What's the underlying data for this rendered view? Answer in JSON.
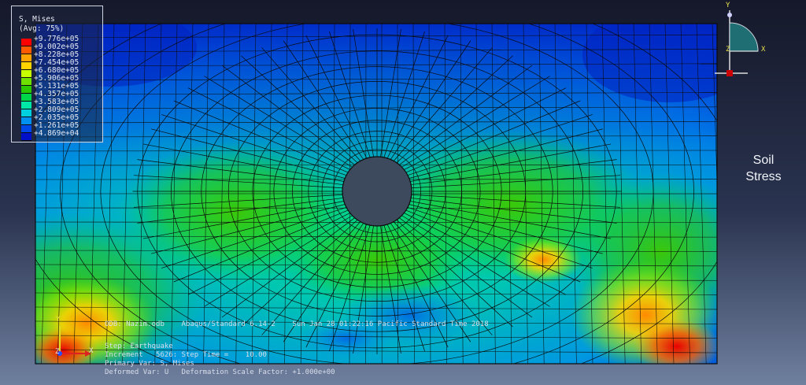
{
  "legend": {
    "variable": "S, Mises",
    "averaging": "(Avg: 75%)",
    "values": [
      "+9.776e+05",
      "+9.002e+05",
      "+8.228e+05",
      "+7.454e+05",
      "+6.680e+05",
      "+5.906e+05",
      "+5.131e+05",
      "+4.357e+05",
      "+3.583e+05",
      "+2.809e+05",
      "+2.035e+05",
      "+1.261e+05",
      "+4.869e+04"
    ],
    "colors": [
      "#ff0000",
      "#ff5a00",
      "#ffa400",
      "#ffd400",
      "#c8ff00",
      "#6ee000",
      "#29c800",
      "#00d64a",
      "#00e8a8",
      "#00cfe0",
      "#0090f0",
      "#0048e8",
      "#0010c8"
    ]
  },
  "side_label": [
    "Soil",
    "Stress"
  ],
  "info_lines": [
    "ODB: Nazim.odb    Abaqus/Standard 6.14-2    Sun Jan 28 01:22:16 Pacific Standard Time 2018",
    "Step: Earthquake",
    "Increment   5626: Step Time =    10.00",
    "Primary Var: S, Mises",
    "Deformed Var: U   Deformation Scale Factor: +1.000e+00"
  ],
  "view_triad": {
    "y_label": "Y",
    "x_label": "X",
    "z_label": "Z",
    "fill": "#1e6e74",
    "dot": "#cc0000"
  },
  "origin_triad": {
    "y_label": "Y",
    "x_label": "X",
    "z_label": "Z"
  },
  "colors": {
    "tunnel": "#3d4a5e",
    "mesh_line": "#0b0b0b"
  }
}
